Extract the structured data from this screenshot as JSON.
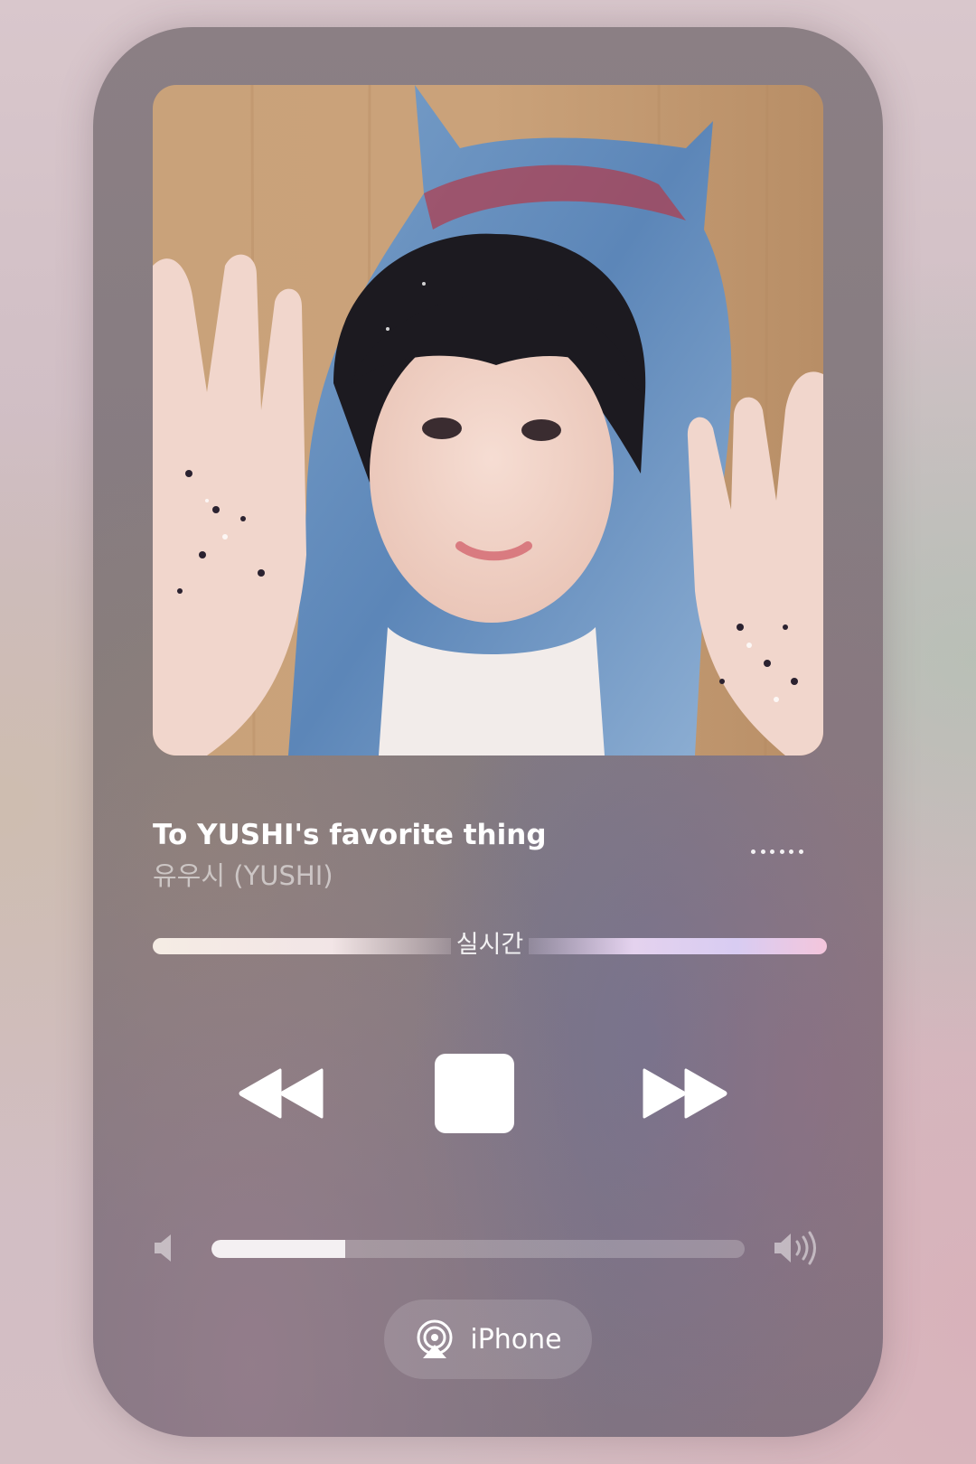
{
  "player": {
    "artwork_icon": "album-artwork",
    "title": "To YUSHI's favorite thing",
    "artist": "유우시 (YUSHI)",
    "more_icon": "more-dots-icon",
    "live_label": "실시간",
    "controls": {
      "rewind_icon": "rewind-icon",
      "stop_icon": "stop-icon",
      "forward_icon": "fast-forward-icon"
    },
    "volume": {
      "level": 0.25,
      "low_icon": "speaker-low-icon",
      "high_icon": "speaker-high-icon"
    },
    "output": {
      "label": "iPhone",
      "icon": "airplay-icon"
    }
  }
}
